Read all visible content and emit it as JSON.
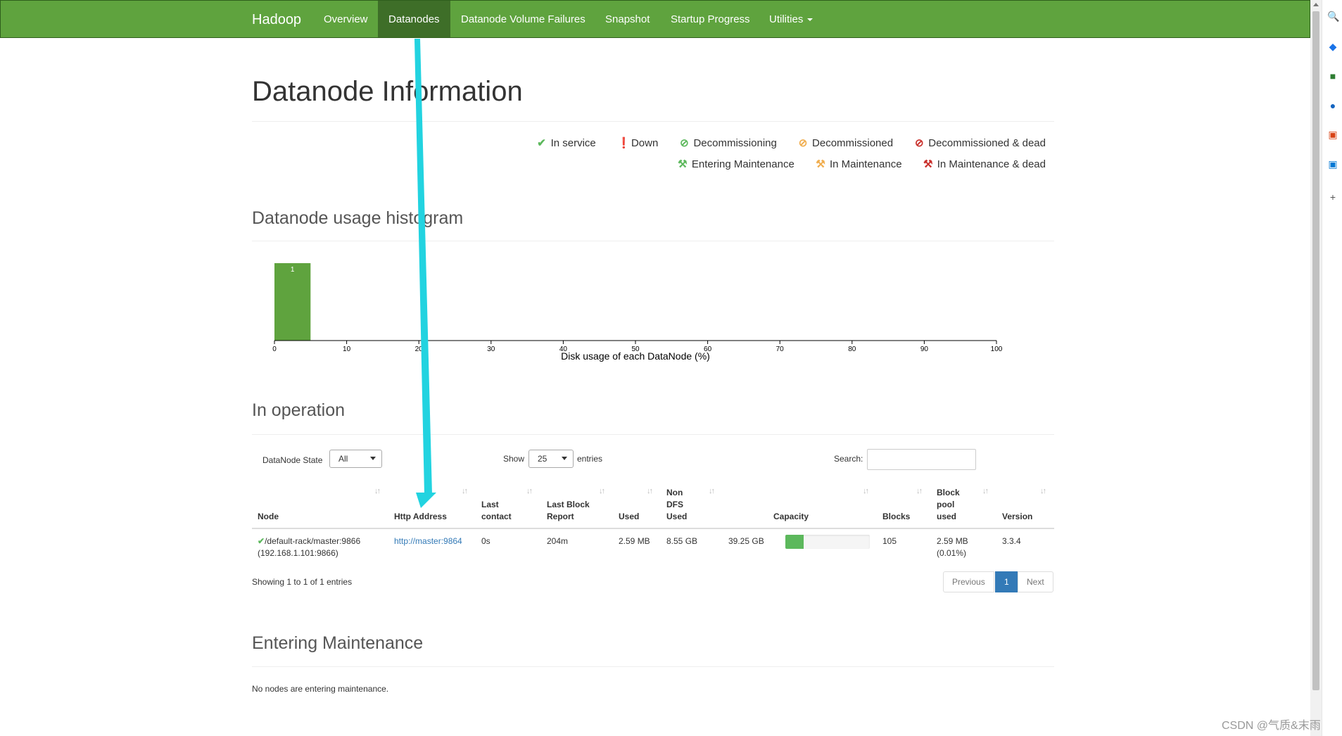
{
  "navbar": {
    "brand": "Hadoop",
    "items": [
      "Overview",
      "Datanodes",
      "Datanode Volume Failures",
      "Snapshot",
      "Startup Progress",
      "Utilities"
    ],
    "active": "Datanodes",
    "color": "#5fa33e"
  },
  "page_title": "Datanode Information",
  "legend": [
    {
      "label": "In service",
      "icon": "check-icon",
      "color": "#5cb85c"
    },
    {
      "label": "Down",
      "icon": "exclamation-circle-icon",
      "color": "#c9302c"
    },
    {
      "label": "Decommissioning",
      "icon": "ban-icon",
      "color": "#5cb85c"
    },
    {
      "label": "Decommissioned",
      "icon": "ban-icon",
      "color": "#f0ad4e"
    },
    {
      "label": "Decommissioned & dead",
      "icon": "ban-icon",
      "color": "#c9302c"
    },
    {
      "label": "Entering Maintenance",
      "icon": "wrench-icon",
      "color": "#5cb85c"
    },
    {
      "label": "In Maintenance",
      "icon": "wrench-icon",
      "color": "#f0ad4e"
    },
    {
      "label": "In Maintenance & dead",
      "icon": "wrench-icon",
      "color": "#c9302c"
    }
  ],
  "histogram_section": {
    "title": "Datanode usage histogram"
  },
  "chart_data": {
    "type": "bar",
    "bins": [
      [
        0,
        5
      ]
    ],
    "values": [
      1
    ],
    "xlabel": "Disk usage of each DataNode (%)",
    "xlim": [
      0,
      100
    ],
    "x_ticks": [
      0,
      10,
      20,
      30,
      40,
      50,
      60,
      70,
      80,
      90,
      100
    ],
    "bar_color": "#5fa33e",
    "grid": false
  },
  "operation": {
    "title": "In operation",
    "state_label": "DataNode State",
    "state_value": "All",
    "show_label": "Show",
    "show_value": "25",
    "entries_label": "entries",
    "search_label": "Search:",
    "search_value": "",
    "columns": [
      "Node",
      "Http Address",
      "Last\ncontact",
      "Last Block\nReport",
      "Used",
      "Non\nDFS\nUsed",
      "Capacity",
      "Blocks",
      "Block\npool\nused",
      "Version"
    ],
    "rows": [
      {
        "node": "/default-rack/master:9866",
        "node_ip": "(192.168.1.101:9866)",
        "http_address": "http://master:9864",
        "last_contact": "0s",
        "last_block_report": "204m",
        "used": "2.59 MB",
        "non_dfs_used": "8.55 GB",
        "capacity": "39.25 GB",
        "capacity_used_fraction": 0.22,
        "blocks": "105",
        "block_pool_used": "2.59 MB",
        "block_pool_pct": "(0.01%)",
        "version": "3.3.4"
      }
    ],
    "summary": "Showing 1 to 1 of 1 entries",
    "pager": {
      "previous": "Previous",
      "page": "1",
      "next": "Next"
    }
  },
  "maintenance": {
    "title": "Entering Maintenance",
    "message": "No nodes are entering maintenance."
  },
  "watermark": "CSDN @气质&末雨"
}
